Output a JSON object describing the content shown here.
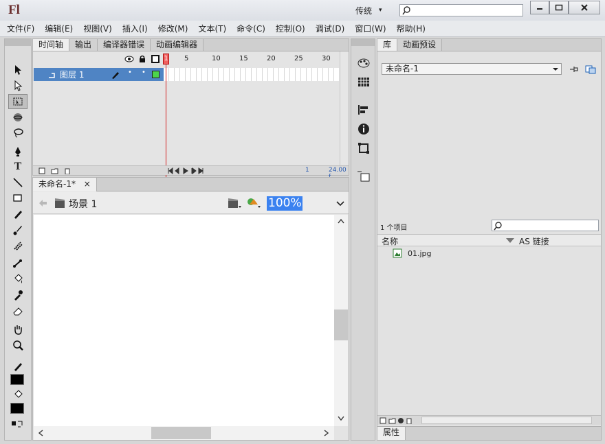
{
  "app": {
    "logo": "Fl",
    "workspace": "传统"
  },
  "menu": [
    "文件(F)",
    "编辑(E)",
    "视图(V)",
    "插入(I)",
    "修改(M)",
    "文本(T)",
    "命令(C)",
    "控制(O)",
    "调试(D)",
    "窗口(W)",
    "帮助(H)"
  ],
  "timeline": {
    "tabs": [
      "时间轴",
      "输出",
      "编译器错误",
      "动画编辑器"
    ],
    "frame_numbers": [
      "1",
      "5",
      "10",
      "15",
      "20",
      "25",
      "30"
    ],
    "layer_name": "图层 1",
    "current_frame": "1",
    "fps": "24.00 f"
  },
  "stage": {
    "doc_tab": "未命名-1*",
    "close": "×",
    "scene": "场景 1",
    "zoom": "100%"
  },
  "library": {
    "tabs": [
      "库",
      "动画预设"
    ],
    "doc_select": "未命名-1",
    "count": "1 个项目",
    "col_name": "名称",
    "col_link": "AS 链接",
    "items": [
      {
        "name": "01.jpg"
      }
    ]
  },
  "properties": {
    "tab": "属性"
  },
  "colors": {
    "layer_highlight": "#4f84c4",
    "playhead": "#d42020",
    "zoom_highlight": "#3b82f0",
    "brand": "#6b2f2f"
  }
}
